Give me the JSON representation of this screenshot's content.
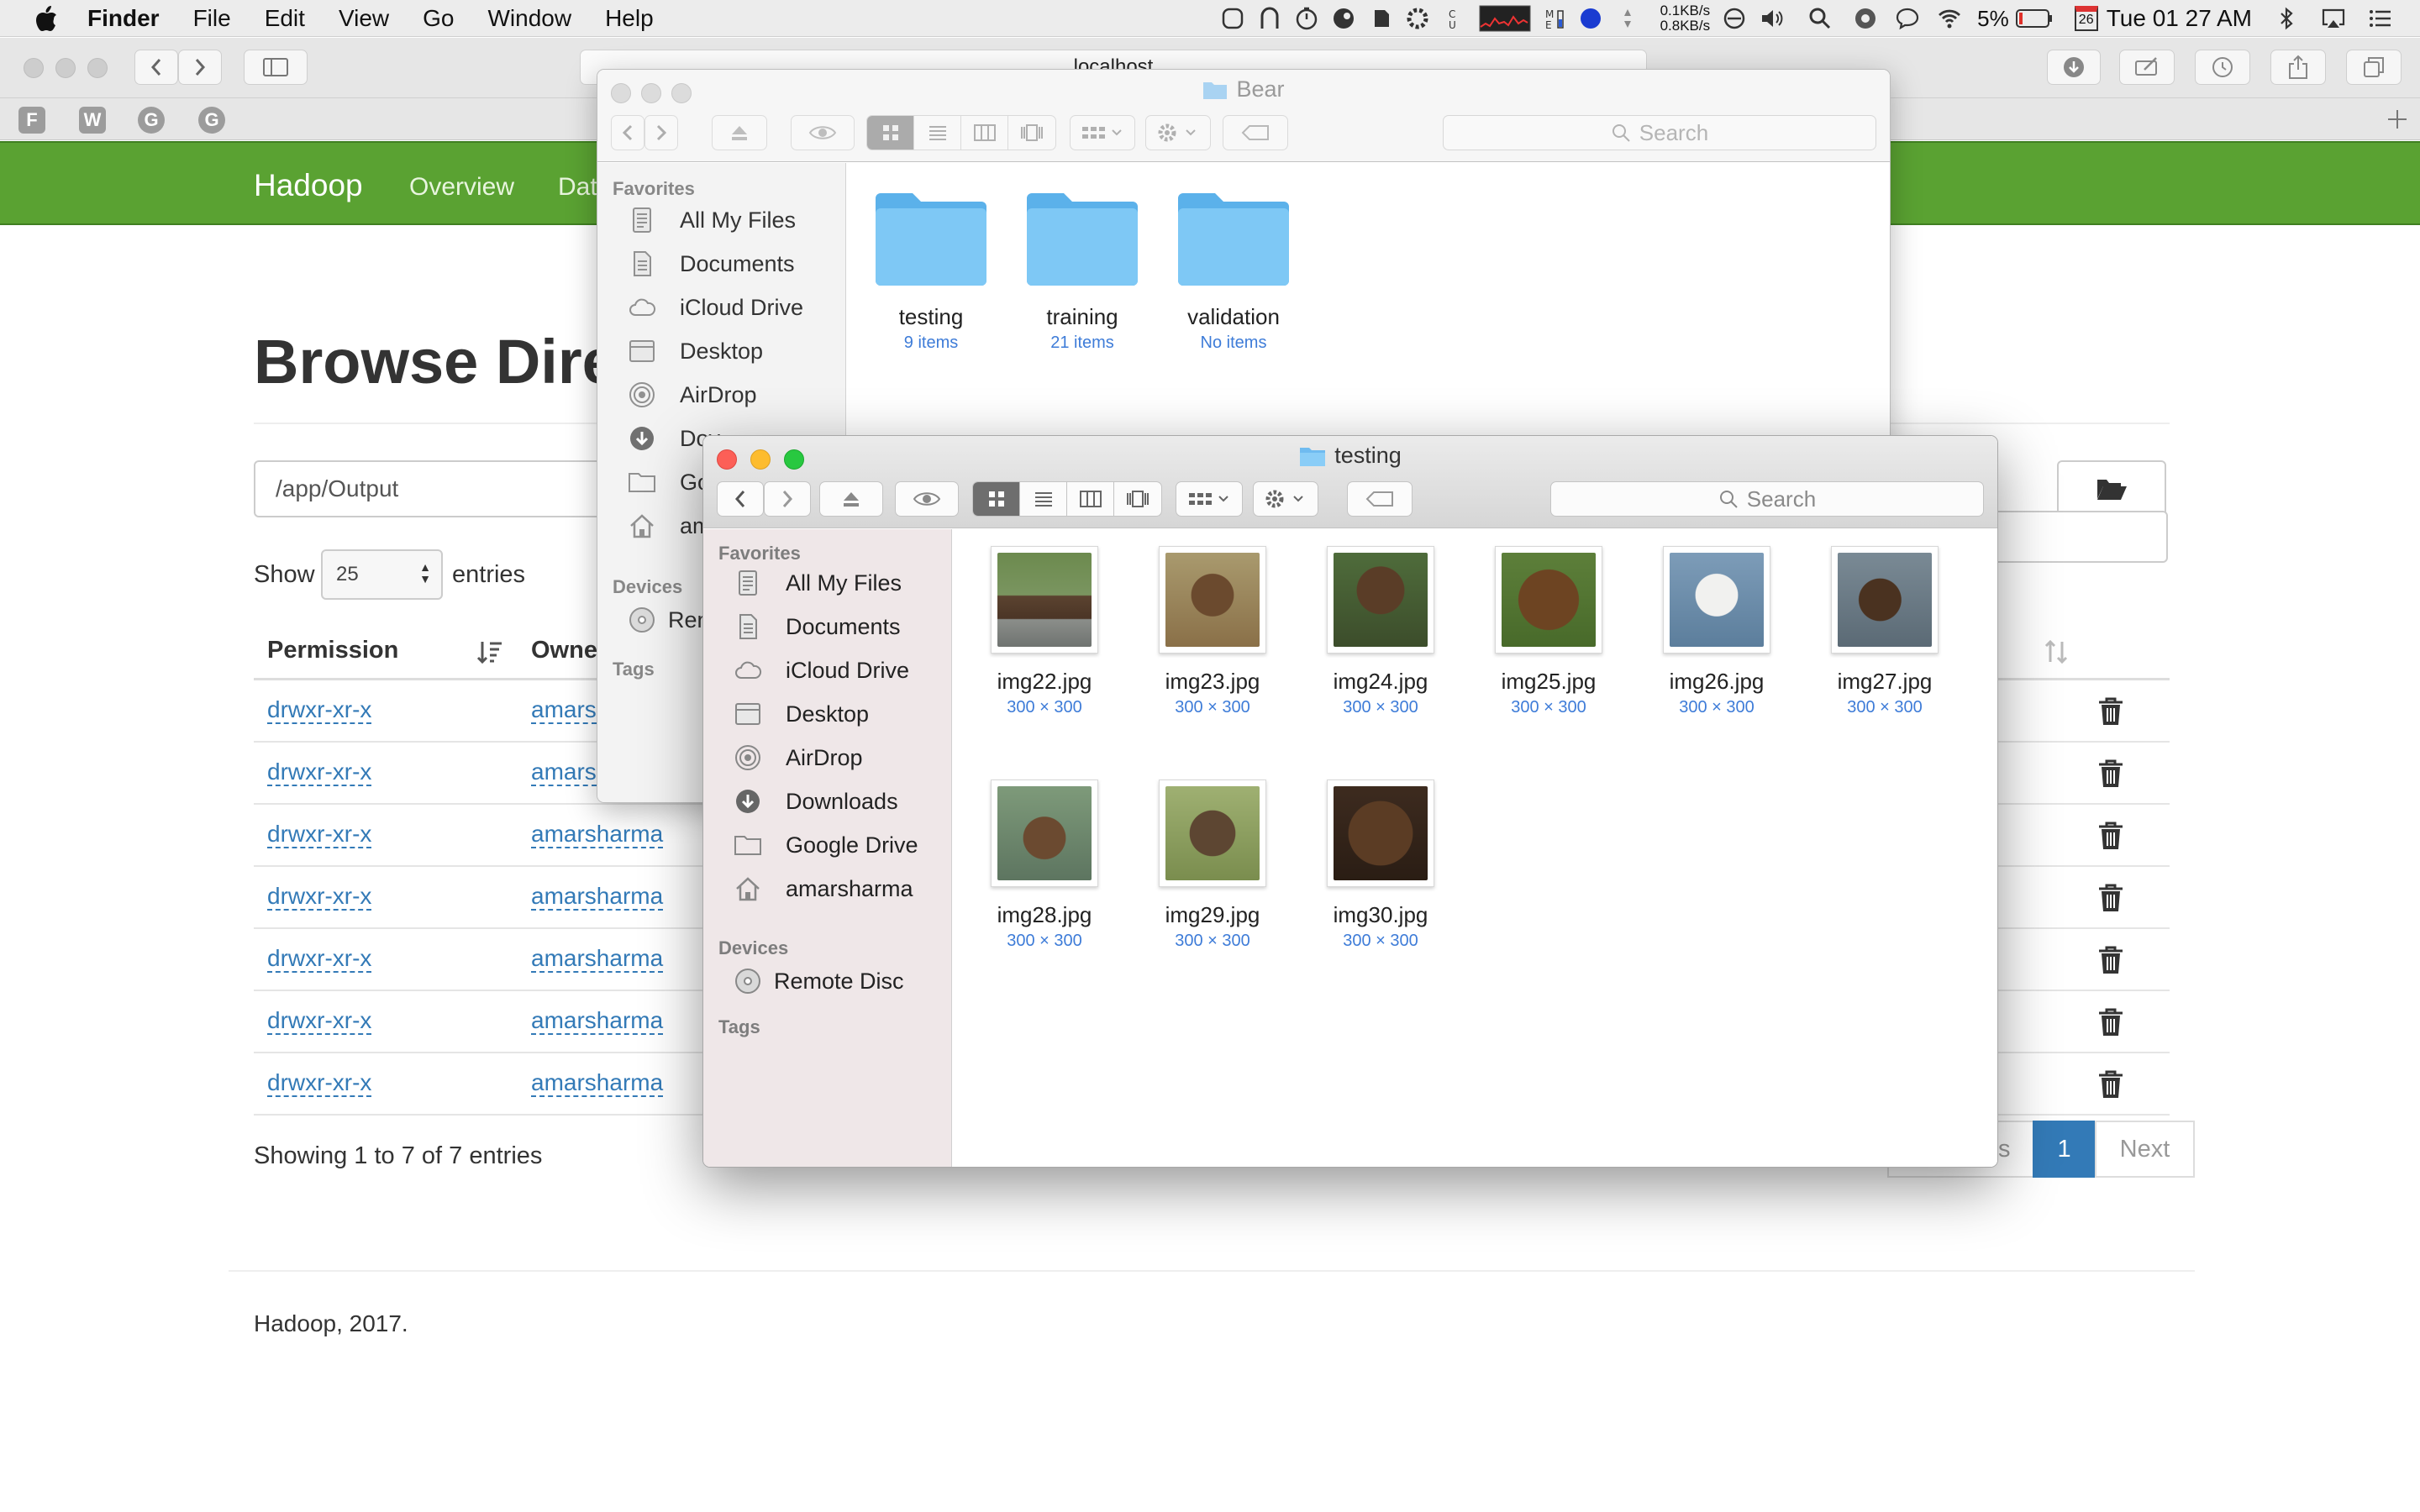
{
  "menubar": {
    "app_name": "Finder",
    "menus": [
      "File",
      "Edit",
      "View",
      "Go",
      "Window",
      "Help"
    ],
    "net_up": "0.1KB/s",
    "net_down": "0.8KB/s",
    "battery": "5%",
    "calendar_day": "26",
    "clock": "Tue 01 27 AM"
  },
  "safari": {
    "url": "localhost",
    "bookmarks": [
      "F",
      "W",
      "G",
      "G"
    ]
  },
  "webpage": {
    "brand": "Hadoop",
    "nav": [
      "Overview",
      "Dat"
    ],
    "heading": "Browse Directory",
    "directory_path": "/app/Output",
    "show_label": "Show",
    "entries_per_page": "25",
    "entries_label": "entries",
    "columns": [
      "Permission",
      "Owne"
    ],
    "rows": [
      {
        "permission": "drwxr-xr-x",
        "owner": "amars"
      },
      {
        "permission": "drwxr-xr-x",
        "owner": "amars"
      },
      {
        "permission": "drwxr-xr-x",
        "owner": "amarsharma"
      },
      {
        "permission": "drwxr-xr-x",
        "owner": "amarsharma"
      },
      {
        "permission": "drwxr-xr-x",
        "owner": "amarsharma"
      },
      {
        "permission": "drwxr-xr-x",
        "owner": "amarsharma"
      },
      {
        "permission": "drwxr-xr-x",
        "owner": "amarsharma"
      }
    ],
    "showing_text": "Showing 1 to 7 of 7 entries",
    "pagination": {
      "prev": "s",
      "current": "1",
      "next": "Next"
    },
    "footer": "Hadoop, 2017.",
    "accent": "#5aa232",
    "link_color": "#337ab7"
  },
  "bear_window": {
    "title": "Bear",
    "search_placeholder": "Search",
    "sidebar_heading_favorites": "Favorites",
    "sidebar_favorites": [
      "All My Files",
      "Documents",
      "iCloud Drive",
      "Desktop",
      "AirDrop",
      "Dov",
      "Goo",
      "ama"
    ],
    "sidebar_heading_devices": "Devices",
    "sidebar_devices": [
      "Ren"
    ],
    "sidebar_heading_tags": "Tags",
    "folders": [
      {
        "name": "testing",
        "sub": "9 items"
      },
      {
        "name": "training",
        "sub": "21 items"
      },
      {
        "name": "validation",
        "sub": "No items"
      }
    ]
  },
  "testing_window": {
    "title": "testing",
    "search_placeholder": "Search",
    "sidebar_heading_favorites": "Favorites",
    "sidebar_favorites": [
      "All My Files",
      "Documents",
      "iCloud Drive",
      "Desktop",
      "AirDrop",
      "Downloads",
      "Google Drive",
      "amarsharma"
    ],
    "sidebar_heading_devices": "Devices",
    "sidebar_devices": [
      "Remote Disc"
    ],
    "sidebar_heading_tags": "Tags",
    "files": [
      {
        "name": "img22.jpg",
        "dims": "300 × 300"
      },
      {
        "name": "img23.jpg",
        "dims": "300 × 300"
      },
      {
        "name": "img24.jpg",
        "dims": "300 × 300"
      },
      {
        "name": "img25.jpg",
        "dims": "300 × 300"
      },
      {
        "name": "img26.jpg",
        "dims": "300 × 300"
      },
      {
        "name": "img27.jpg",
        "dims": "300 × 300"
      },
      {
        "name": "img28.jpg",
        "dims": "300 × 300"
      },
      {
        "name": "img29.jpg",
        "dims": "300 × 300"
      },
      {
        "name": "img30.jpg",
        "dims": "300 × 300"
      }
    ]
  }
}
